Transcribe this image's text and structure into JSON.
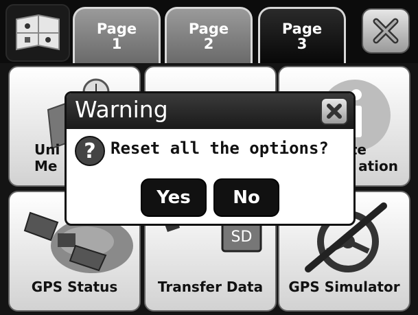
{
  "tabs": [
    {
      "line1": "Page",
      "line2": "1",
      "active": false
    },
    {
      "line1": "Page",
      "line2": "2",
      "active": false
    },
    {
      "line1": "Page",
      "line2": "3",
      "active": true
    }
  ],
  "tiles": {
    "units_line1": "Uni",
    "units_line2": "Me",
    "info_line1": "te",
    "info_line2": "ation",
    "gps_status": "GPS Status",
    "transfer_data": "Transfer Data",
    "sd_label": "SD",
    "gps_simulator": "GPS Simulator"
  },
  "dialog": {
    "title": "Warning",
    "question_mark": "?",
    "message": "Reset all the options?",
    "yes_label": "Yes",
    "no_label": "No"
  },
  "colors": {
    "dialog_title_bg": "#2a2a2a",
    "button_bg": "#111111",
    "tile_bg": "#e8e8e8"
  }
}
